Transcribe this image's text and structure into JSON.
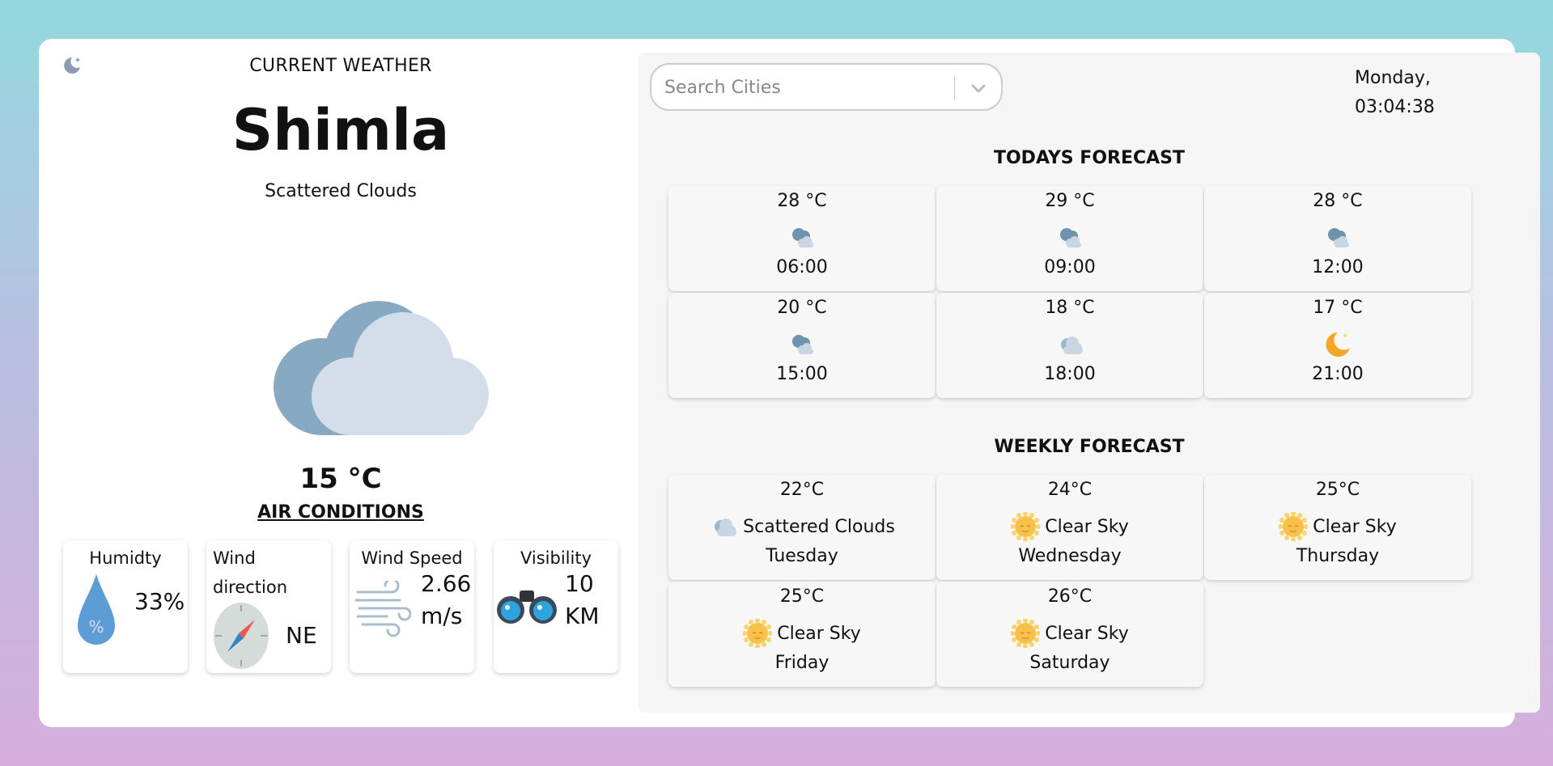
{
  "current": {
    "label": "CURRENT WEATHER",
    "city": "Shimla",
    "description": "Scattered Clouds",
    "temperature": "15 °C",
    "icon": "cloud-icon"
  },
  "air": {
    "title": "AIR CONDITIONS",
    "humidity": {
      "label": "Humidty",
      "value": "33%",
      "icon": "humidity-drop-icon"
    },
    "wind_direction": {
      "label_1": "Wind",
      "label_2": "direction",
      "value": "NE",
      "icon": "compass-icon"
    },
    "wind_speed": {
      "label": "Wind Speed",
      "value_1": "2.66",
      "value_2": "m/s",
      "icon": "wind-icon"
    },
    "visibility": {
      "label": "Visibility",
      "value_1": "10",
      "value_2": "KM",
      "icon": "binoculars-icon"
    }
  },
  "search": {
    "placeholder": "Search Cities",
    "value": ""
  },
  "datetime": {
    "day": "Monday,",
    "time": "03:04:38"
  },
  "today": {
    "title": "TODAYS FORECAST",
    "items": [
      {
        "temp": "28 °C",
        "time": "06:00",
        "icon": "cloud-rain-icon"
      },
      {
        "temp": "29 °C",
        "time": "09:00",
        "icon": "cloud-rain-icon"
      },
      {
        "temp": "28 °C",
        "time": "12:00",
        "icon": "cloud-rain-icon"
      },
      {
        "temp": "20 °C",
        "time": "15:00",
        "icon": "cloud-rain-icon"
      },
      {
        "temp": "18 °C",
        "time": "18:00",
        "icon": "cloud-icon"
      },
      {
        "temp": "17 °C",
        "time": "21:00",
        "icon": "moon-icon"
      }
    ]
  },
  "weekly": {
    "title": "WEEKLY FORECAST",
    "items": [
      {
        "temp": "22°C",
        "desc": "Scattered Clouds",
        "day": "Tuesday",
        "icon": "cloud-icon"
      },
      {
        "temp": "24°C",
        "desc": "Clear Sky",
        "day": "Wednesday",
        "icon": "sun-icon"
      },
      {
        "temp": "25°C",
        "desc": "Clear Sky",
        "day": "Thursday",
        "icon": "sun-icon"
      },
      {
        "temp": "25°C",
        "desc": "Clear Sky",
        "day": "Friday",
        "icon": "sun-icon"
      },
      {
        "temp": "26°C",
        "desc": "Clear Sky",
        "day": "Saturday",
        "icon": "sun-icon"
      }
    ]
  },
  "colors": {
    "cloud_back": "#87a9c2",
    "cloud_front": "#d3deea",
    "sun": "#f7c14a",
    "moon": "#f5a623",
    "drop": "#5e9cd6"
  }
}
